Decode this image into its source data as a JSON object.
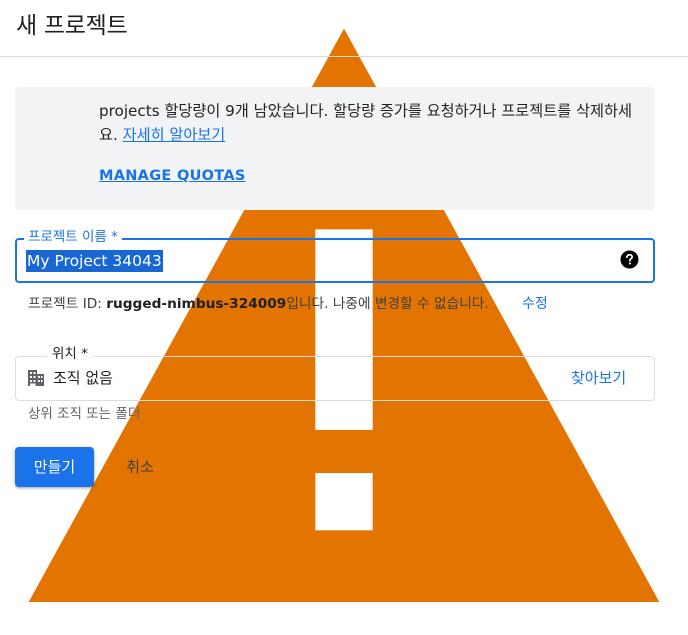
{
  "header": {
    "title": "새 프로젝트"
  },
  "notice": {
    "message": "projects 할당량이 9개 남았습니다. 할당량 증가를 요청하거나 프로젝트를 삭제하세요. ",
    "learn_more": "자세히 알아보기",
    "manage_quotas": "MANAGE QUOTAS",
    "icon": "warning-icon",
    "icon_color": "#e37400"
  },
  "project_name": {
    "label": "프로젝트 이름 *",
    "value": "My Project 34043",
    "help_icon": "help-circle-icon"
  },
  "project_id": {
    "prefix": "프로젝트 ID: ",
    "value": "rugged-nimbus-324009",
    "suffix": "입니다. 나중에 변경할 수 없습니다.",
    "edit_label": "수정"
  },
  "location": {
    "label": "위치 *",
    "value": "조직 없음",
    "browse_label": "찾아보기",
    "hint": "상위 조직 또는 폴더",
    "icon": "building-icon"
  },
  "actions": {
    "create_label": "만들기",
    "cancel_label": "취소"
  },
  "colors": {
    "accent": "#1a73e8",
    "notice_bg": "#f1f3f4",
    "selection": "#1967d2"
  }
}
